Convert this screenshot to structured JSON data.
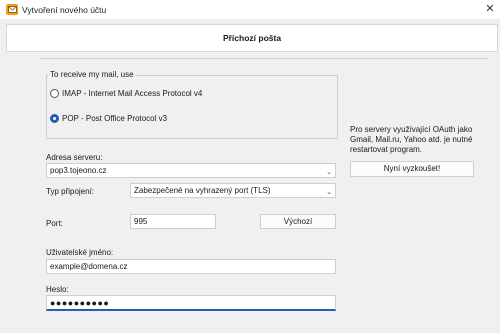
{
  "window": {
    "title": "Vytvoření nového účtu",
    "close_glyph": "✕"
  },
  "header": {
    "title": "Příchozí pošta"
  },
  "protocol_group": {
    "legend": "To receive my mail, use",
    "options": [
      {
        "label": "IMAP - Internet Mail Access Protocol v4",
        "selected": false
      },
      {
        "label": "POP  -  Post Office Protocol v3",
        "selected": true
      }
    ]
  },
  "server": {
    "label": "Adresa serveru:",
    "value": "pop3.tojeono.cz"
  },
  "connection": {
    "label": "Typ připojení:",
    "value": "Zabezpečené na vyhrazený port (TLS)"
  },
  "port": {
    "label": "Port:",
    "value": "995",
    "default_button": "Výchozí"
  },
  "username": {
    "label": "Uživatelské jméno:",
    "value": "example@domena.cz"
  },
  "password": {
    "label": "Heslo:",
    "value": "●●●●●●●●●●"
  },
  "oauth": {
    "note": "Pro servery využívající OAuth jako Gmail, Mail.ru, Yahoo atd. je nutné restartovat program.",
    "button": "Nyní vyzkoušet!"
  },
  "icons": {
    "app": "envelope-icon",
    "close": "close-icon",
    "dropdown": "chevron-down-icon"
  }
}
